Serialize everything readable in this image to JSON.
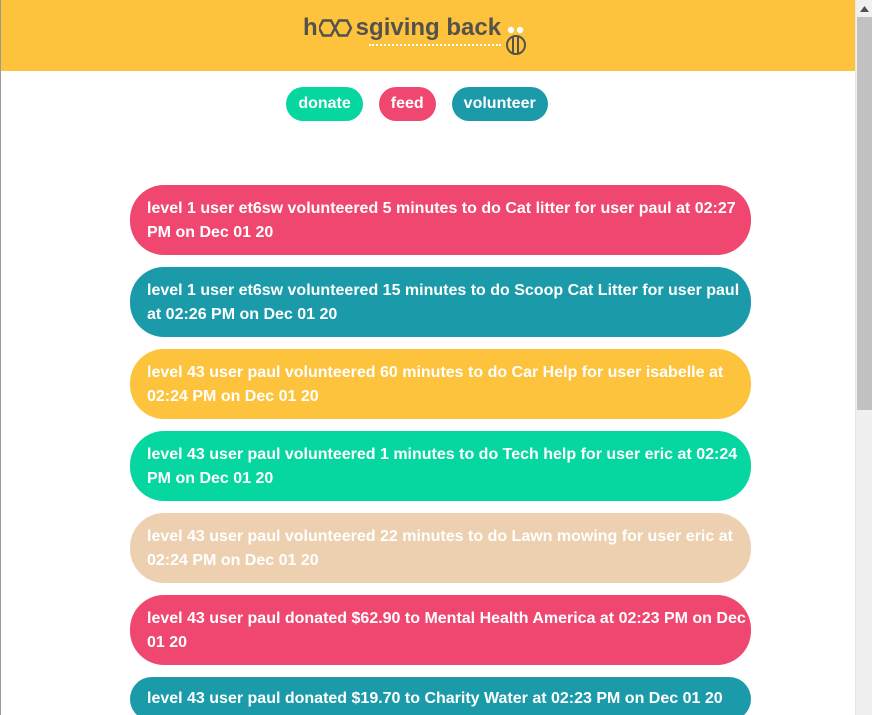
{
  "brand": {
    "logo_h": "h",
    "logo_s": "s",
    "logo_rest": " giving back",
    "logo_full_text": "hoos giving back",
    "colors": {
      "header": "#fdc33d",
      "logo_text": "#55524d",
      "green": "#06d6a0",
      "pink": "#ef476f",
      "teal": "#1b9aaa",
      "yellow": "#fdc33d",
      "tan": "#edd0b0"
    },
    "icons": [
      "hexagon-icon",
      "bee-icon"
    ]
  },
  "nav": {
    "donate_label": "donate",
    "feed_label": "feed",
    "volunteer_label": "volunteer"
  },
  "feed": {
    "items": [
      {
        "text": "level 1 user et6sw volunteered 5 minutes to do Cat litter for user paul at 02:27 PM on Dec 01 20",
        "color": "pink"
      },
      {
        "text": "level 1 user et6sw volunteered 15 minutes to do Scoop Cat Litter for user paul at 02:26 PM on Dec 01 20",
        "color": "teal"
      },
      {
        "text": "level 43 user paul volunteered 60 minutes to do Car Help for user isabelle at 02:24 PM on Dec 01 20",
        "color": "yellow"
      },
      {
        "text": "level 43 user paul volunteered 1 minutes to do Tech help for user eric at 02:24 PM on Dec 01 20",
        "color": "green"
      },
      {
        "text": "level 43 user paul volunteered 22 minutes to do Lawn mowing for user eric at 02:24 PM on Dec 01 20",
        "color": "tan"
      },
      {
        "text": "level 43 user paul donated $62.90 to Mental Health America at 02:23 PM on Dec 01 20",
        "color": "pink"
      },
      {
        "text": "level 43 user paul donated $19.70 to Charity Water at 02:23 PM on Dec 01 20",
        "color": "teal"
      }
    ]
  },
  "scrollbar": {
    "icon": "scroll-up-arrow-icon"
  }
}
